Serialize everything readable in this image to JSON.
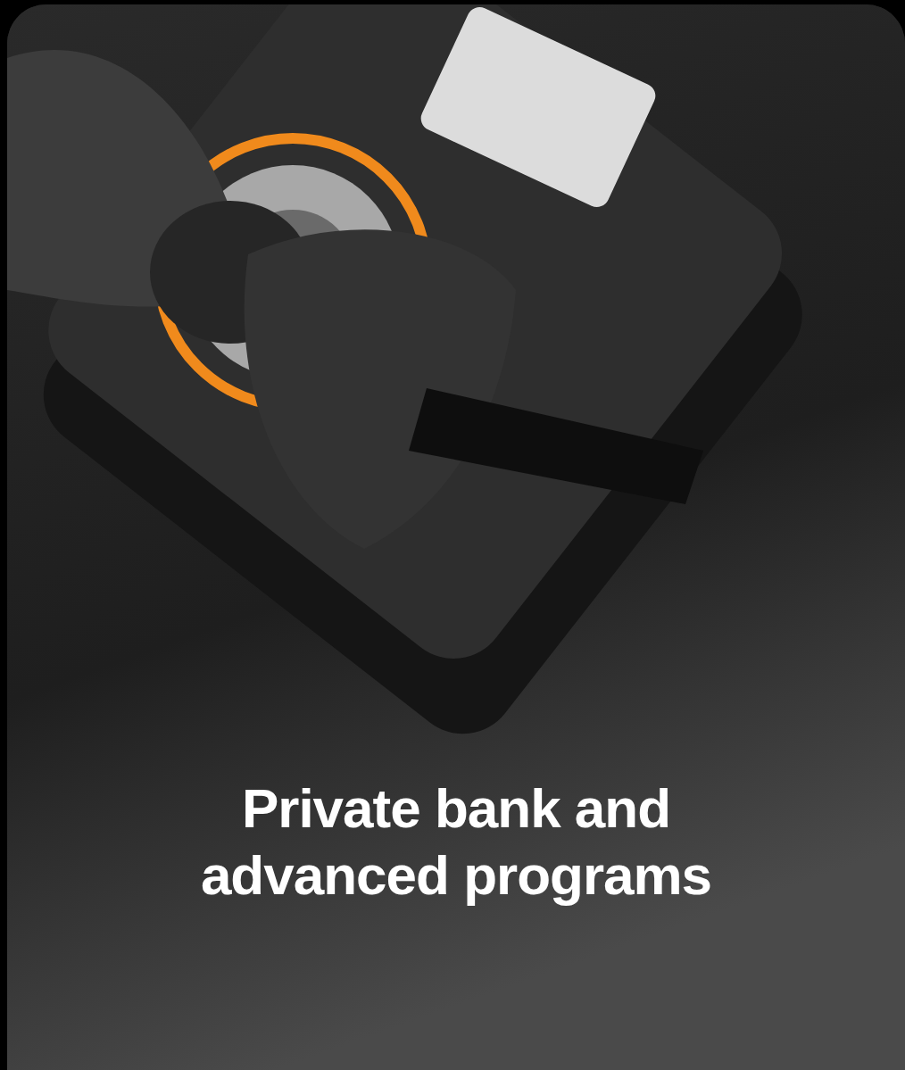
{
  "card": {
    "title": "Private bank and\nadvanced programs"
  }
}
